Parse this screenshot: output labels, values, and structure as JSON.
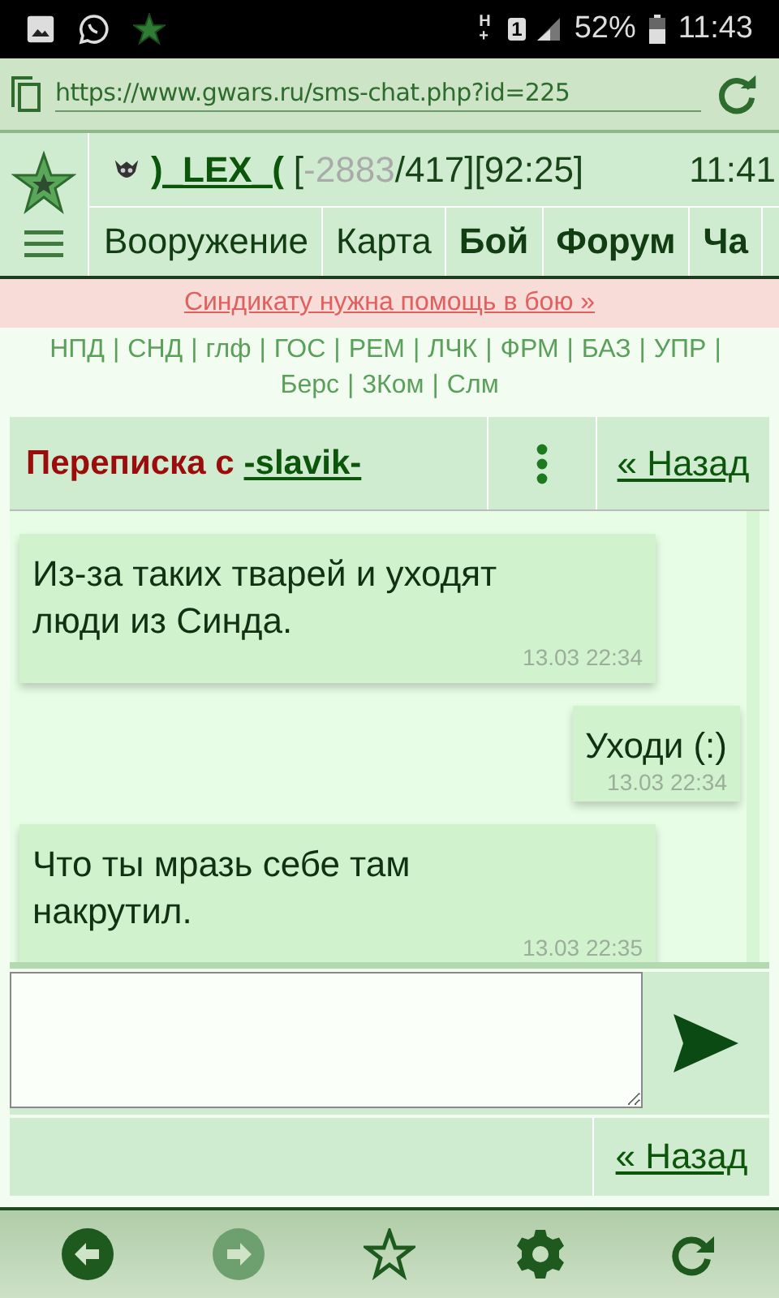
{
  "status_bar": {
    "network": "H+",
    "sim": "1",
    "battery": "52%",
    "time": "11:43"
  },
  "browser": {
    "url": "https://www.gwars.ru/sms-chat.php?id=225"
  },
  "header": {
    "user_name": ")_LEX_(",
    "stats_open": "[",
    "hp": "-2883",
    "stats_rest": "/417][92:25]",
    "clock": "11:41",
    "nav": [
      {
        "label": "Вооружение",
        "bold": false
      },
      {
        "label": "Карта",
        "bold": false
      },
      {
        "label": "Бой",
        "bold": true
      },
      {
        "label": "Форум",
        "bold": true
      },
      {
        "label": "Ча",
        "bold": true
      }
    ]
  },
  "alert": "Синдикату нужна помощь в бою »",
  "quick_links": {
    "separator": "|",
    "items": [
      "НПД",
      "СНД",
      "глф",
      "ГОС",
      "РЕМ",
      "ЛЧК",
      "ФРМ",
      "БАЗ",
      "УПР",
      "Берс",
      "3Ком",
      "Слм"
    ]
  },
  "chat": {
    "title": "Переписка с",
    "partner": "-slavik-",
    "back": "« Назад",
    "messages": [
      {
        "text": "Из-за таких тварей и уходят люди из Синда.",
        "time": "13.03 22:34",
        "outgoing": false
      },
      {
        "text": "Уходи (:)",
        "time": "13.03 22:34",
        "outgoing": true
      },
      {
        "text": "Что ты мразь себе там накрутил.",
        "time": "13.03 22:35",
        "outgoing": false
      }
    ]
  },
  "footer_back": "« Назад",
  "toolbar": [
    {
      "kind": "back",
      "disabled": false
    },
    {
      "kind": "forward",
      "disabled": true
    },
    {
      "kind": "star",
      "disabled": false
    },
    {
      "kind": "settings",
      "disabled": false
    },
    {
      "kind": "reload",
      "disabled": false
    }
  ]
}
